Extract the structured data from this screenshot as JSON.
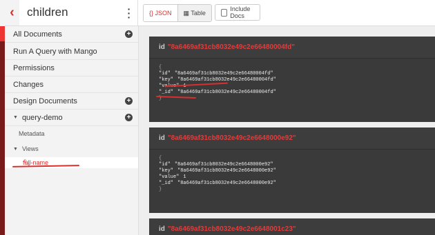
{
  "header": {
    "db_name": "children",
    "view_json": "{} JSON",
    "view_table": "▦ Table",
    "include_docs": "Include Docs"
  },
  "sidebar": {
    "all_documents": "All Documents",
    "run_query": "Run A Query with Mango",
    "permissions": "Permissions",
    "changes": "Changes",
    "design_documents": "Design Documents",
    "design_doc": "query-demo",
    "metadata": "Metadata",
    "views": "Views",
    "view_name": "full-name"
  },
  "docs": [
    {
      "id_label": "id",
      "id": "\"8a6469af31cb8032e49c2e66480004fd\"",
      "open_brace": "{",
      "rows": [
        {
          "key": "\"id\"",
          "value": "\"8a6469af31cb8032e49c2e66480004fd\""
        },
        {
          "key": "\"key\"",
          "value": "\"8a6469af31cb8032e49c2e66480004fd\""
        },
        {
          "key": "\"value\"",
          "value": "1"
        },
        {
          "key": "\"_id\"",
          "value": "\"8a6469af31cb8032e49c2e66480004fd\""
        }
      ],
      "close_brace": "}"
    },
    {
      "id_label": "id",
      "id": "\"8a6469af31cb8032e49c2e6648000e92\"",
      "open_brace": "{",
      "rows": [
        {
          "key": "\"id\"",
          "value": "\"8a6469af31cb8032e49c2e6648000e92\""
        },
        {
          "key": "\"key\"",
          "value": "\"8a6469af31cb8032e49c2e6648000e92\""
        },
        {
          "key": "\"value\"",
          "value": "1"
        },
        {
          "key": "\"_id\"",
          "value": "\"8a6469af31cb8032e49c2e6648000e92\""
        }
      ],
      "close_brace": "}"
    },
    {
      "id_label": "id",
      "id": "\"8a6469af31cb8032e49c2e6648001c23\""
    }
  ],
  "colors": {
    "accent": "#d9302e",
    "doc_bg": "#3a3a3a",
    "sidebar_bg": "#f3f3f3"
  }
}
